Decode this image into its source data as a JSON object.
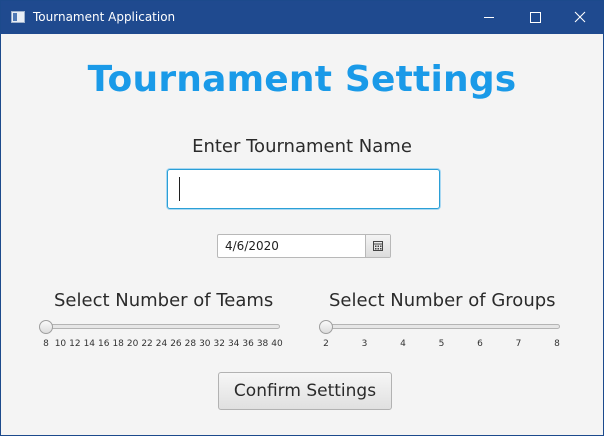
{
  "window": {
    "title": "Tournament Application",
    "titlebar_color": "#1f4a8f",
    "buttons": [
      "minimize-icon",
      "maximize-icon",
      "close-icon"
    ]
  },
  "main": {
    "heading": "Tournament Settings",
    "heading_color": "#1a9ae8",
    "name_label": "Enter Tournament Name",
    "name_value": "",
    "date_value": "4/6/2020",
    "date_button_icon": "calendar-icon",
    "teams": {
      "label": "Select Number of Teams",
      "value": 8,
      "ticks": [
        "8",
        "10",
        "12",
        "14",
        "16",
        "18",
        "20",
        "22",
        "24",
        "26",
        "28",
        "30",
        "32",
        "34",
        "36",
        "38",
        "40"
      ]
    },
    "groups": {
      "label": "Select Number of Groups",
      "value": 2,
      "ticks": [
        "2",
        "3",
        "4",
        "5",
        "6",
        "7",
        "8"
      ]
    },
    "confirm_label": "Confirm Settings"
  }
}
